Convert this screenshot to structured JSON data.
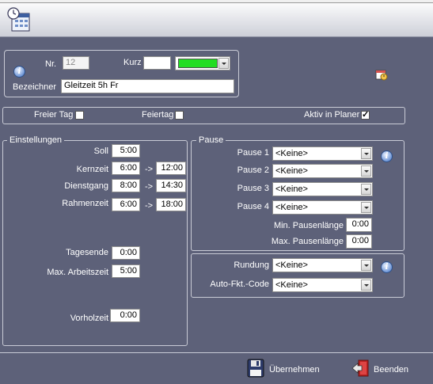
{
  "header": {
    "icon": "time-schedule-icon"
  },
  "top": {
    "nr_label": "Nr.",
    "nr_value": "12",
    "kurz_label": "Kurz",
    "kurz_value": "",
    "color_value": "#22dd22",
    "bezeichner_label": "Bezeichner",
    "bezeichner_value": "Gleitzeit 5h Fr"
  },
  "flags": {
    "freier_tag_label": "Freier Tag",
    "freier_tag_checked": false,
    "feiertag_label": "Feiertag",
    "feiertag_checked": false,
    "aktiv_label": "Aktiv in Planer",
    "aktiv_checked": true
  },
  "einstellungen": {
    "title": "Einstellungen",
    "soll_label": "Soll",
    "soll_value": "5:00",
    "kernzeit_label": "Kernzeit",
    "kernzeit_from": "6:00",
    "kernzeit_to": "12:00",
    "dienstgang_label": "Dienstgang",
    "dienstgang_from": "8:00",
    "dienstgang_to": "14:30",
    "rahmenzeit_label": "Rahmenzeit",
    "rahmenzeit_from": "6:00",
    "rahmenzeit_to": "18:00",
    "arrow": "->",
    "tagesende_label": "Tagesende",
    "tagesende_value": "0:00",
    "max_arbeitszeit_label": "Max. Arbeitszeit",
    "max_arbeitszeit_value": "5:00",
    "vorholzeit_label": "Vorholzeit",
    "vorholzeit_value": "0:00"
  },
  "pause": {
    "title": "Pause",
    "pause1_label": "Pause 1",
    "pause1_value": "<Keine>",
    "pause2_label": "Pause 2",
    "pause2_value": "<Keine>",
    "pause3_label": "Pause 3",
    "pause3_value": "<Keine>",
    "pause4_label": "Pause 4",
    "pause4_value": "<Keine>",
    "min_label": "Min. Pausenlänge",
    "min_value": "0:00",
    "max_label": "Max. Pausenlänge",
    "max_value": "0:00"
  },
  "rundung": {
    "rundung_label": "Rundung",
    "rundung_value": "<Keine>",
    "auto_label": "Auto-Fkt.-Code",
    "auto_value": "<Keine>"
  },
  "footer": {
    "save_label": "Übernehmen",
    "exit_label": "Beenden"
  }
}
